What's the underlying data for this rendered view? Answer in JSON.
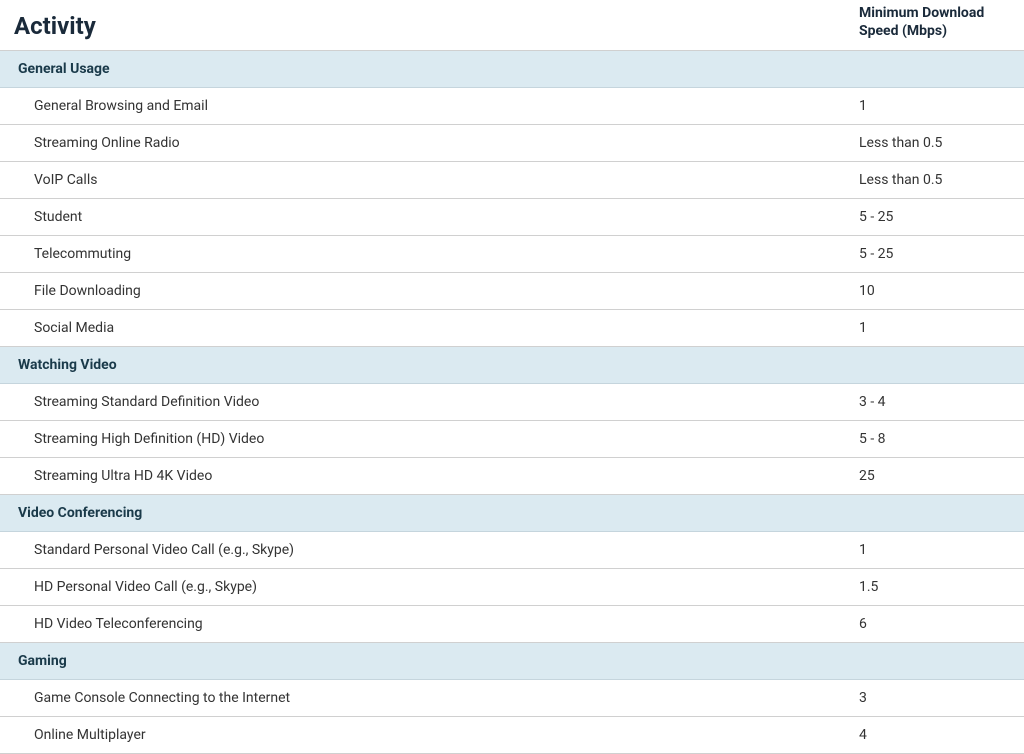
{
  "headers": {
    "activity": "Activity",
    "speed": "Minimum Download Speed (Mbps)"
  },
  "sections": [
    {
      "category": "General Usage",
      "rows": [
        {
          "activity": "General Browsing and Email",
          "speed": "1"
        },
        {
          "activity": "Streaming Online Radio",
          "speed": "Less than 0.5"
        },
        {
          "activity": "VoIP Calls",
          "speed": "Less than 0.5"
        },
        {
          "activity": "Student",
          "speed": "5 - 25"
        },
        {
          "activity": "Telecommuting",
          "speed": "5 - 25"
        },
        {
          "activity": "File Downloading",
          "speed": "10"
        },
        {
          "activity": "Social Media",
          "speed": "1"
        }
      ]
    },
    {
      "category": "Watching Video",
      "rows": [
        {
          "activity": "Streaming Standard Definition Video",
          "speed": "3 - 4"
        },
        {
          "activity": "Streaming High Definition (HD) Video",
          "speed": "5 - 8"
        },
        {
          "activity": "Streaming Ultra HD 4K Video",
          "speed": "25"
        }
      ]
    },
    {
      "category": "Video Conferencing",
      "rows": [
        {
          "activity": "Standard Personal Video Call (e.g., Skype)",
          "speed": "1"
        },
        {
          "activity": "HD Personal Video Call (e.g., Skype)",
          "speed": "1.5"
        },
        {
          "activity": "HD Video Teleconferencing",
          "speed": "6"
        }
      ]
    },
    {
      "category": "Gaming",
      "rows": [
        {
          "activity": "Game Console Connecting to the Internet",
          "speed": "3"
        },
        {
          "activity": "Online Multiplayer",
          "speed": "4"
        }
      ]
    }
  ]
}
